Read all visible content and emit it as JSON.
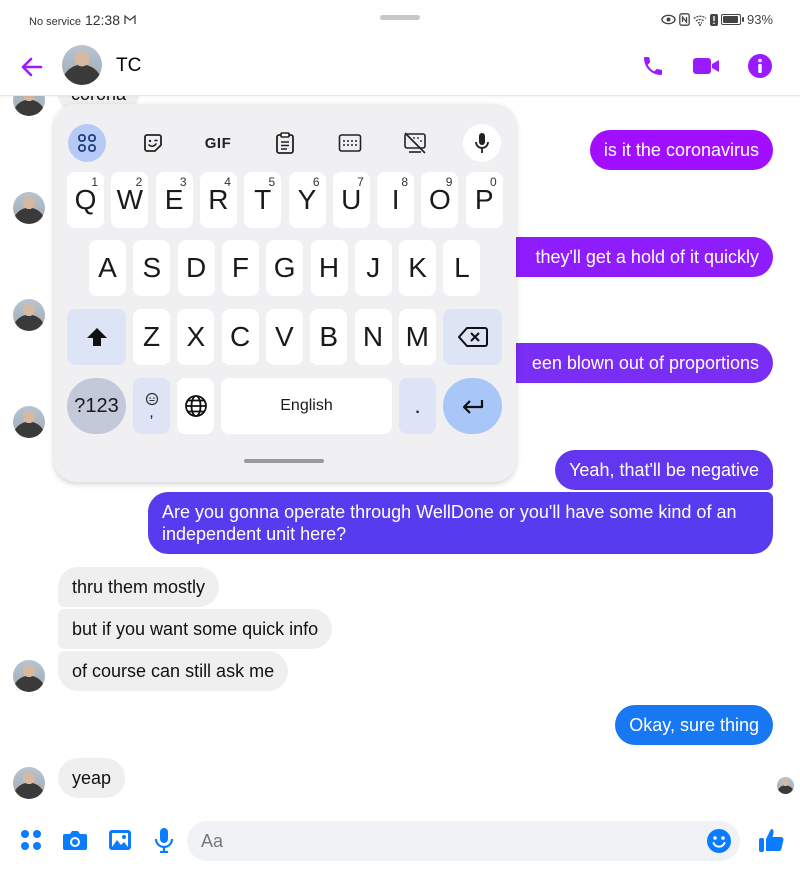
{
  "status_bar": {
    "carrier": "No service",
    "time": "12:38",
    "mail_icon": "M",
    "battery_percent": "93%",
    "battery_level": 0.93
  },
  "header": {
    "contact_name": "TC",
    "back_icon": "arrow-left",
    "actions": [
      "phone-icon",
      "video-icon",
      "info-icon"
    ]
  },
  "colors": {
    "accent_purple": "#9b1bff",
    "bubble_gradient_top": "#a10dff",
    "bubble_gradient_mid": "#7a2df4",
    "bubble_gradient_low": "#5a3ef0",
    "bubble_blue": "#1877f2",
    "composer_blue": "#0a7cff",
    "incoming_bg": "#efefef"
  },
  "messages": [
    {
      "side": "in",
      "text": "corona",
      "partial": true
    },
    {
      "side": "out",
      "text": "is it the coronavirus"
    },
    {
      "side": "out",
      "text": "they'll get a hold of it quickly",
      "partial": true
    },
    {
      "side": "out",
      "text": "een blown out of proportions",
      "partial": true
    },
    {
      "side": "out",
      "text": "Yeah, that'll be negative"
    },
    {
      "side": "out",
      "text": "Are you gonna operate through WellDone or you'll have some kind of an independent unit here?"
    },
    {
      "side": "in",
      "text": "thru them mostly"
    },
    {
      "side": "in",
      "text": "but if you want some quick info"
    },
    {
      "side": "in",
      "text": "of course can still ask me"
    },
    {
      "side": "out",
      "text": "Okay, sure thing"
    },
    {
      "side": "in",
      "text": "yeap"
    }
  ],
  "keyboard": {
    "toolbar": [
      "apps-grid-icon",
      "sticker-icon",
      "GIF",
      "clipboard-icon",
      "keyboard-layout-icon",
      "hide-keyboard-icon",
      "microphone-icon"
    ],
    "gif_label": "GIF",
    "row1": [
      {
        "key": "Q",
        "hint": "1"
      },
      {
        "key": "W",
        "hint": "2"
      },
      {
        "key": "E",
        "hint": "3"
      },
      {
        "key": "R",
        "hint": "4"
      },
      {
        "key": "T",
        "hint": "5"
      },
      {
        "key": "Y",
        "hint": "6"
      },
      {
        "key": "U",
        "hint": "7"
      },
      {
        "key": "I",
        "hint": "8"
      },
      {
        "key": "O",
        "hint": "9"
      },
      {
        "key": "P",
        "hint": "0"
      }
    ],
    "row2": [
      "A",
      "S",
      "D",
      "F",
      "G",
      "H",
      "J",
      "K",
      "L"
    ],
    "row3": [
      "Z",
      "X",
      "C",
      "V",
      "B",
      "N",
      "M"
    ],
    "symbols_label": "?123",
    "comma_label": ",",
    "space_label": "English",
    "period_label": "."
  },
  "composer": {
    "placeholder": "Aa",
    "value": ""
  }
}
